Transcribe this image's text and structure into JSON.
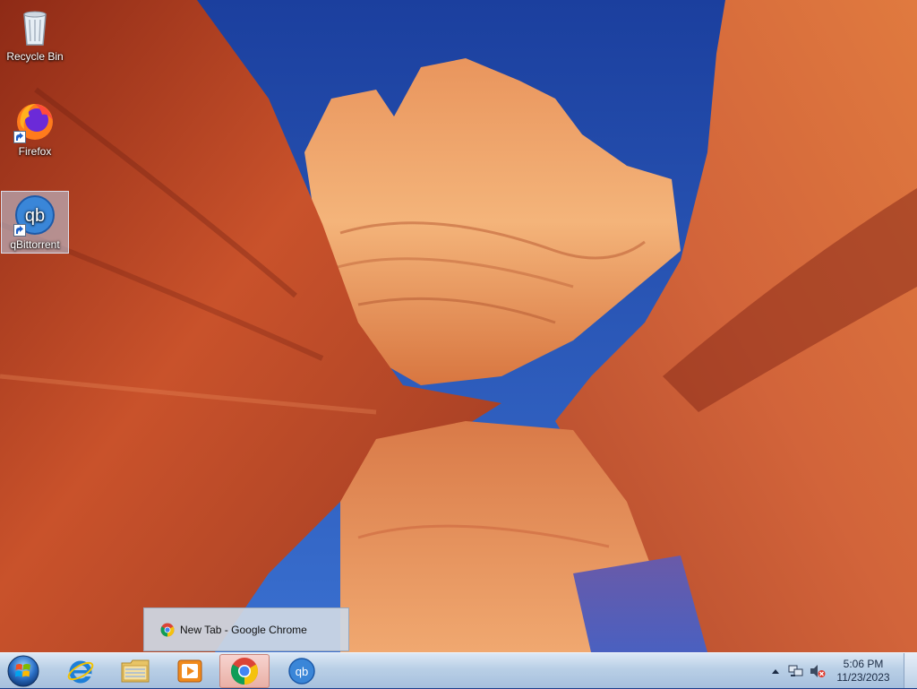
{
  "desktop": {
    "icons": [
      {
        "label": "Recycle Bin",
        "icon": "recycle-bin-icon"
      },
      {
        "label": "Firefox",
        "icon": "firefox-icon"
      },
      {
        "label": "qBittorrent",
        "icon": "qbittorrent-icon"
      }
    ]
  },
  "taskbar": {
    "start": {
      "icon": "windows-start-orb-icon"
    },
    "pinned": [
      {
        "name": "Internet Explorer",
        "icon": "internet-explorer-icon"
      },
      {
        "name": "Windows Explorer",
        "icon": "folder-icon"
      },
      {
        "name": "Windows Media Player",
        "icon": "media-player-icon"
      },
      {
        "name": "Google Chrome",
        "icon": "chrome-icon",
        "active": true
      },
      {
        "name": "qBittorrent",
        "icon": "qbittorrent-icon"
      }
    ],
    "preview": {
      "title": "New Tab - Google Chrome",
      "icon": "chrome-icon"
    },
    "tray": {
      "show_hidden_icon": "chevron-up-icon",
      "network_icon": "network-icon",
      "volume_icon": "volume-muted-icon",
      "time": "5:06 PM",
      "date": "11/23/2023"
    }
  },
  "colors": {
    "sky": "#1f4fb5",
    "rock_light": "#f2a066",
    "rock_dark": "#a8361c",
    "taskbar": "#b9cfe6",
    "active_highlight": "#e9b0a6"
  }
}
